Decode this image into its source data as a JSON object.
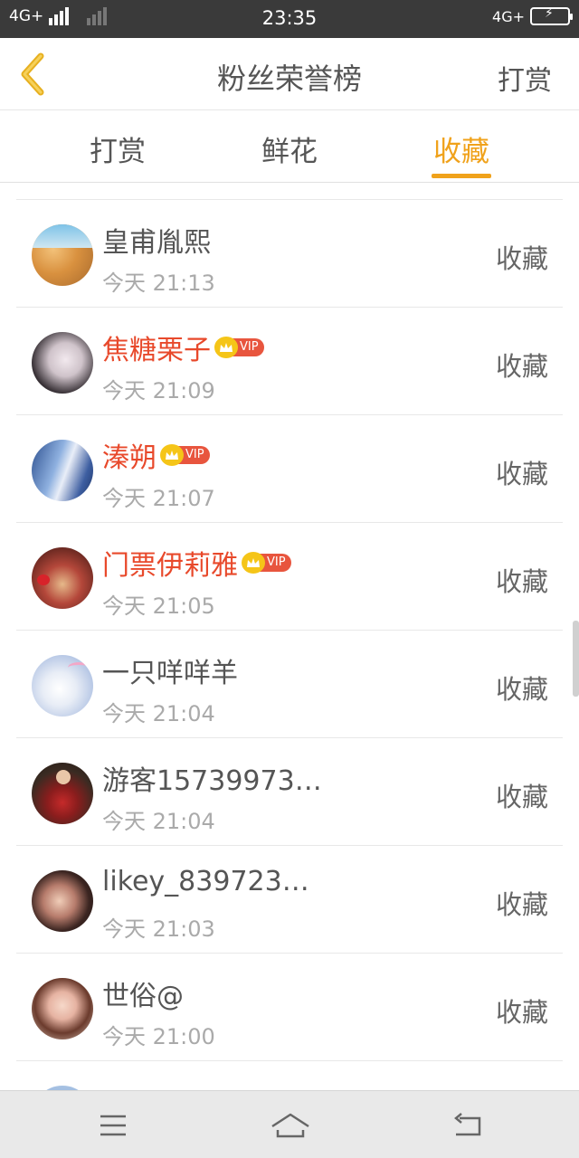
{
  "status_bar": {
    "network_left": "4G+",
    "time": "23:35",
    "network_right": "4G",
    "network_right_plus": "+"
  },
  "nav": {
    "back_icon": "chevron-left-icon",
    "title": "粉丝荣誉榜",
    "action": "打赏"
  },
  "tabs": [
    {
      "label": "打赏",
      "active": false
    },
    {
      "label": "鲜花",
      "active": false
    },
    {
      "label": "收藏",
      "active": true
    }
  ],
  "colors": {
    "accent": "#f0a21b",
    "vip_name": "#e8492b",
    "vip_tag": "#e8553e",
    "crown": "#f5c518"
  },
  "vip_label": "VIP",
  "rows": [
    {
      "name": "皇甫胤熙",
      "time": "今天 21:13",
      "action": "收藏",
      "vip": false
    },
    {
      "name": "焦糖栗子",
      "time": "今天 21:09",
      "action": "收藏",
      "vip": true
    },
    {
      "name": "溱朔",
      "time": "今天 21:07",
      "action": "收藏",
      "vip": true
    },
    {
      "name": "门票伊莉雅",
      "time": "今天 21:05",
      "action": "收藏",
      "vip": true
    },
    {
      "name": "一只咩咩羊",
      "time": "今天 21:04",
      "action": "收藏",
      "vip": false
    },
    {
      "name": "游客15739973…",
      "time": "今天 21:04",
      "action": "收藏",
      "vip": false
    },
    {
      "name": "likey_839723…",
      "time": "今天 21:03",
      "action": "收藏",
      "vip": false
    },
    {
      "name": "世俗@",
      "time": "今天 21:00",
      "action": "收藏",
      "vip": false
    }
  ],
  "system_nav": {
    "menu_icon": "menu-icon",
    "home_icon": "home-icon",
    "back_icon": "back-arrow-icon"
  }
}
